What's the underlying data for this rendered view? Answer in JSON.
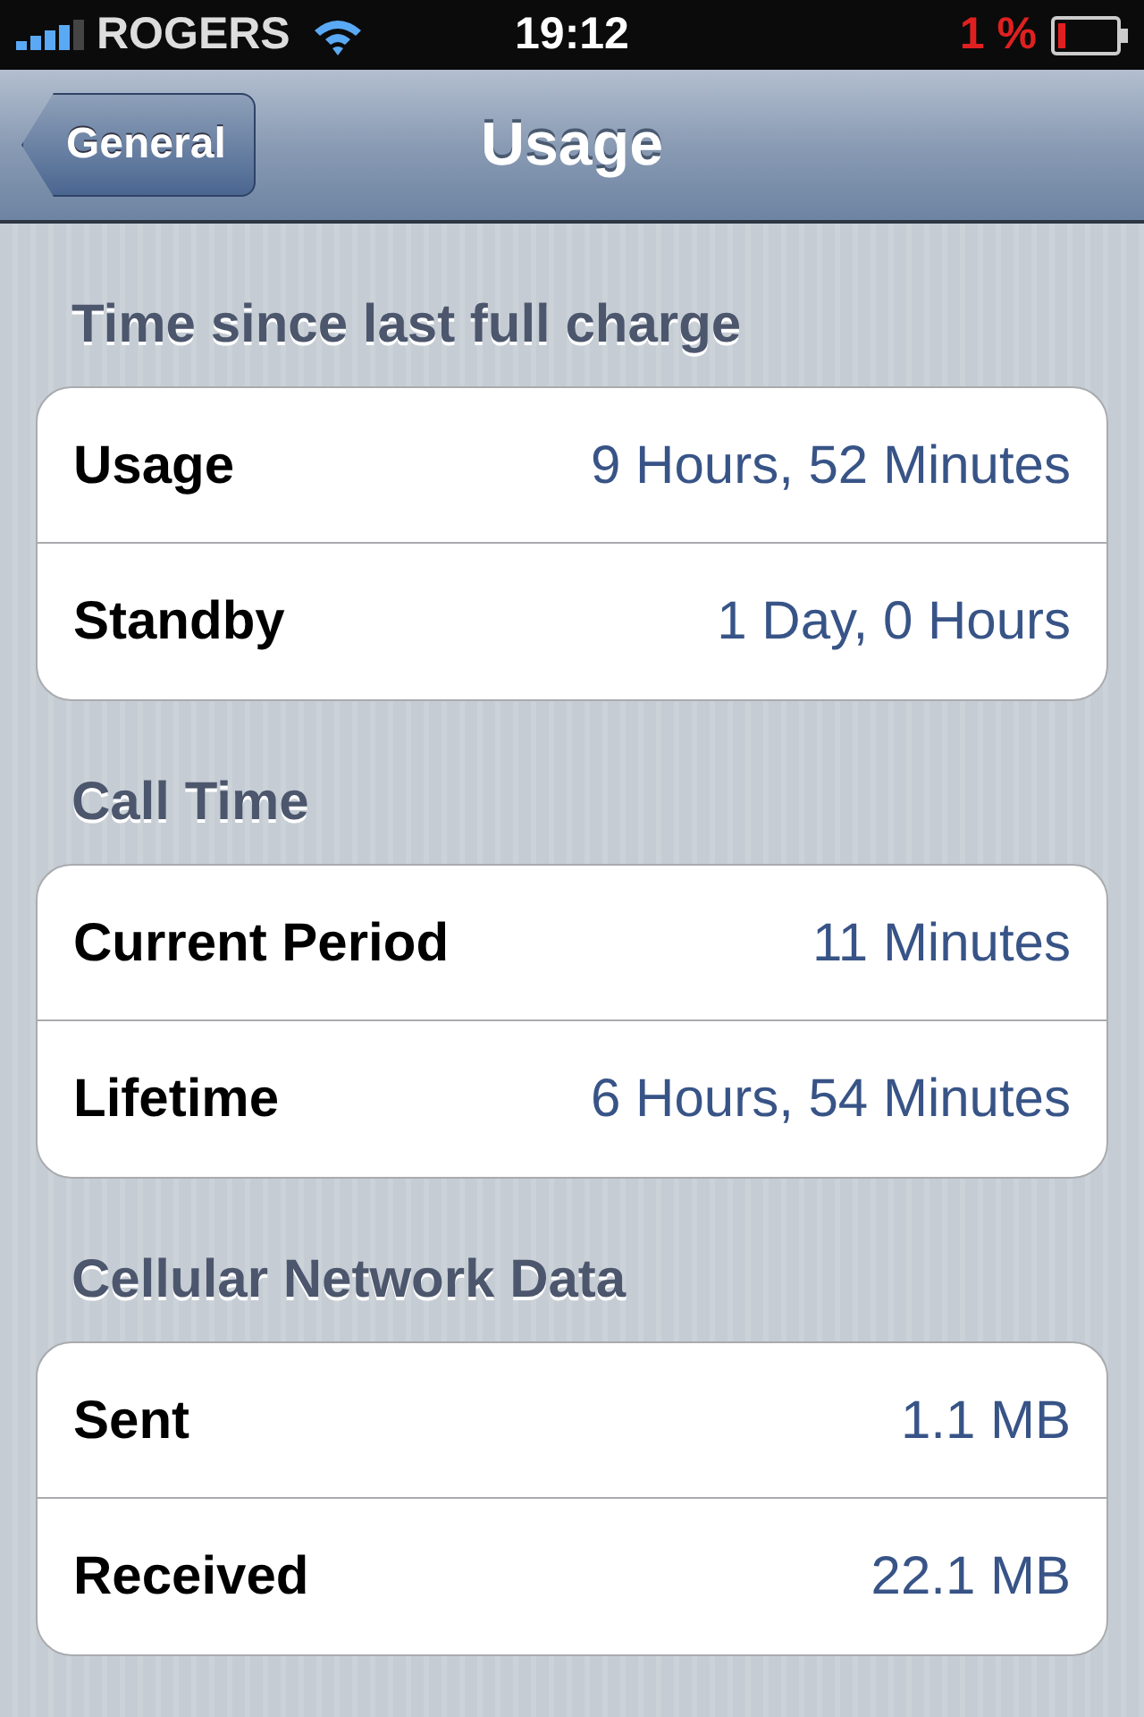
{
  "status_bar": {
    "carrier": "ROGERS",
    "time": "19:12",
    "battery": "1 %"
  },
  "nav_bar": {
    "back": "General",
    "title": "Usage"
  },
  "sections": [
    {
      "header": "Time since last full charge",
      "rows": [
        {
          "label": "Usage",
          "value": "9 Hours, 52 Minutes"
        },
        {
          "label": "Standby",
          "value": "1 Day, 0 Hours"
        }
      ]
    },
    {
      "header": "Call Time",
      "rows": [
        {
          "label": "Current Period",
          "value": "11 Minutes"
        },
        {
          "label": "Lifetime",
          "value": "6 Hours, 54 Minutes"
        }
      ]
    },
    {
      "header": "Cellular Network Data",
      "rows": [
        {
          "label": "Sent",
          "value": "1.1 MB"
        },
        {
          "label": "Received",
          "value": "22.1 MB"
        }
      ]
    }
  ]
}
